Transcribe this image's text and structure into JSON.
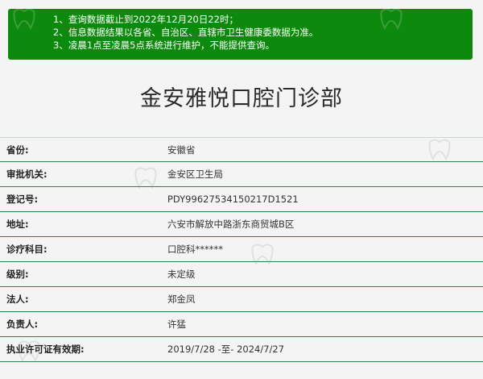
{
  "notice": {
    "lines": [
      "1、查询数据截止到2022年12月20日22时；",
      "2、信息数据结果以各省、自治区、直辖市卫生健康委数据为准。",
      "3、凌晨1点至凌晨5点系统进行维护，不能提供查询。"
    ]
  },
  "page_title": "金安雅悦口腔门诊部",
  "details": [
    {
      "label": "省份:",
      "value": "安徽省"
    },
    {
      "label": "审批机关:",
      "value": "金安区卫生局"
    },
    {
      "label": "登记号:",
      "value": "PDY99627534150217D1521"
    },
    {
      "label": "地址:",
      "value": "六安市解放中路浙东商贸城B区"
    },
    {
      "label": "诊疗科目:",
      "value": "口腔科******"
    },
    {
      "label": "级别:",
      "value": "未定级"
    },
    {
      "label": "法人:",
      "value": "郑金凤"
    },
    {
      "label": "负责人:",
      "value": "许猛"
    },
    {
      "label": "执业许可证有效期:",
      "value": "2019/7/28 -至- 2024/7/27"
    }
  ],
  "watermark_icon": "tooth-logo-icon"
}
